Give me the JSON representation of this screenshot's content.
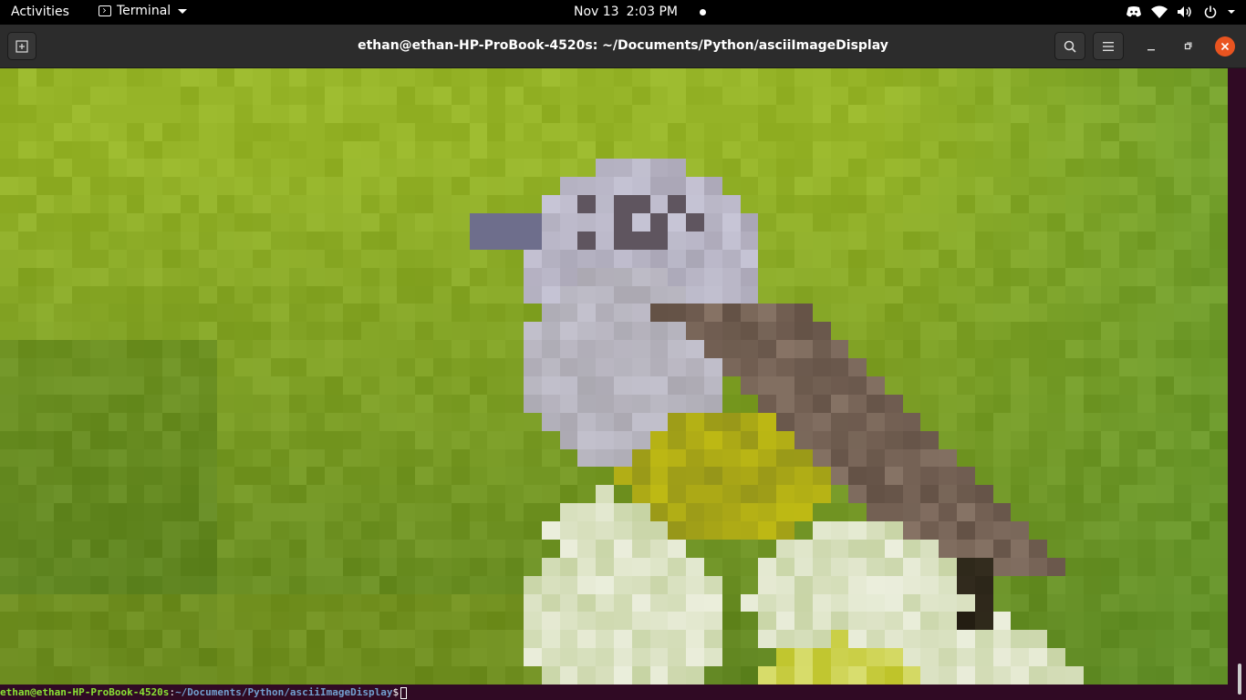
{
  "topbar": {
    "activities": "Activities",
    "app_name": "Terminal",
    "date": "Nov 13",
    "time": "2:03 PM"
  },
  "icons": {
    "app": "terminal-icon",
    "tray": [
      "discord-icon",
      "wifi-icon",
      "volume-icon",
      "power-icon",
      "chevron-down-icon"
    ],
    "header": [
      "new-tab-icon",
      "search-icon",
      "hamburger-menu-icon",
      "minimize-icon",
      "maximize-icon",
      "close-icon"
    ]
  },
  "window": {
    "title": "ethan@ethan-HP-ProBook-4520s: ~/Documents/Python/asciiImageDisplay"
  },
  "terminal": {
    "prompt_user": "ethan@ethan-HP-ProBook-4520s",
    "prompt_colon": ":",
    "prompt_path": "~/Documents/Python/asciiImageDisplay",
    "prompt_symbol": "$",
    "image_description_colors": {
      "background_green": "#8fb33a",
      "bird_gray": "#b8b6c6",
      "bird_wing": "#5d4d44",
      "bird_belly": "#b6b51a",
      "flowers": "#e8ead8"
    }
  },
  "colors": {
    "topbar_bg": "#000000",
    "header_bg": "#2c2c2c",
    "terminal_bg": "#300a24",
    "close_button": "#e95420",
    "prompt_user": "#8ae234",
    "prompt_path": "#729fcf"
  }
}
